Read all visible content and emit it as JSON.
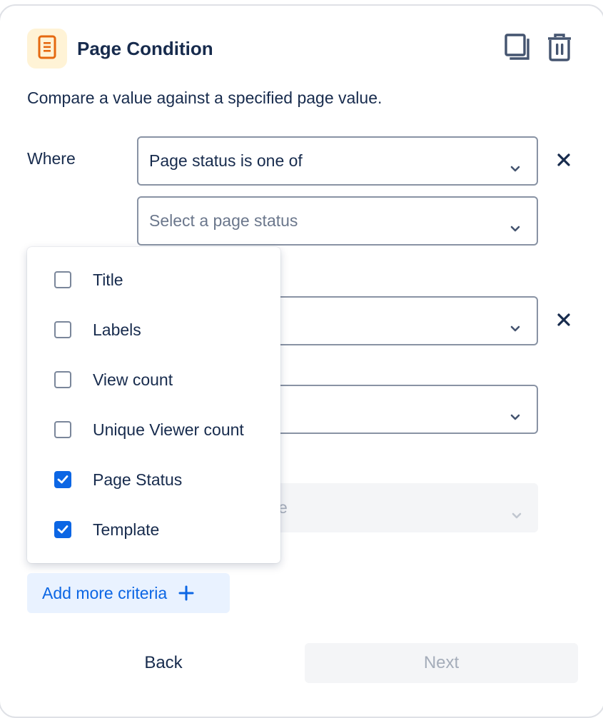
{
  "header": {
    "title": "Page Condition",
    "icon": "page-document-icon",
    "accent_color": "#e56910",
    "badge_color": "#fff3d6",
    "actions": [
      "duplicate-icon",
      "trash-icon"
    ]
  },
  "description": "Compare a value against a specified page value.",
  "where_label": "Where",
  "conditions": {
    "field_select_value": "Page status is one of",
    "status_select_placeholder": "Select a page status",
    "partially_visible_placeholder_fragment": "e"
  },
  "dropdown": {
    "options": [
      {
        "label": "Title",
        "checked": false
      },
      {
        "label": "Labels",
        "checked": false
      },
      {
        "label": "View count",
        "checked": false
      },
      {
        "label": "Unique Viewer count",
        "checked": false
      },
      {
        "label": "Page Status",
        "checked": true
      },
      {
        "label": "Template",
        "checked": true
      }
    ]
  },
  "add_criteria_label": "Add more criteria",
  "footer": {
    "back_label": "Back",
    "next_label": "Next"
  },
  "colors": {
    "primary": "#0c66e4",
    "text": "#172b4d",
    "muted": "#6b778c",
    "disabled_text": "#a5adba"
  }
}
